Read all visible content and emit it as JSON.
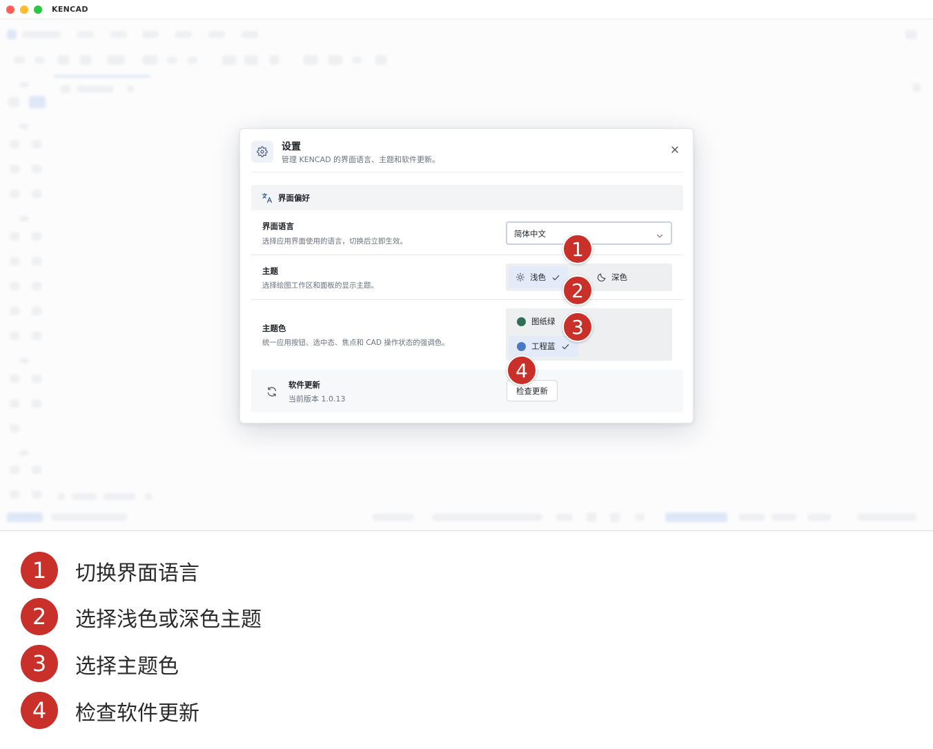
{
  "window": {
    "title": "KENCAD"
  },
  "dialog": {
    "title": "设置",
    "subtitle": "管理 KENCAD 的界面语言、主题和软件更新。",
    "icon": "gear-icon",
    "close_icon": "close-icon",
    "section": {
      "title": "界面偏好",
      "icon": "translate-icon",
      "language": {
        "label": "界面语言",
        "description": "选择应用界面使用的语言，切换后立即生效。",
        "selected": "简体中文"
      },
      "theme": {
        "label": "主题",
        "description": "选择绘图工作区和面板的显示主题。",
        "options": [
          {
            "label": "浅色",
            "icon": "sun-icon",
            "selected": true
          },
          {
            "label": "深色",
            "icon": "moon-icon",
            "selected": false
          }
        ]
      },
      "accent": {
        "label": "主题色",
        "description": "统一应用按钮、选中态、焦点和 CAD 操作状态的强调色。",
        "options": [
          {
            "label": "图纸绿",
            "color": "#2e6f57",
            "selected": false
          },
          {
            "label": "工程蓝",
            "color": "#4a78c4",
            "selected": true
          }
        ]
      }
    },
    "update": {
      "label": "软件更新",
      "version": "当前版本 1.0.13",
      "button": "检查更新",
      "icon": "refresh-icon"
    }
  },
  "markers": [
    "1",
    "2",
    "3",
    "4"
  ],
  "legend": [
    {
      "number": "1",
      "text": "切换界面语言"
    },
    {
      "number": "2",
      "text": "选择浅色或深色主题"
    },
    {
      "number": "3",
      "text": "选择主题色"
    },
    {
      "number": "4",
      "text": "检查软件更新"
    }
  ],
  "colors": {
    "marker": "#c9302a",
    "accent": "#4a78c4",
    "selected_bg": "#e3ebf8"
  }
}
